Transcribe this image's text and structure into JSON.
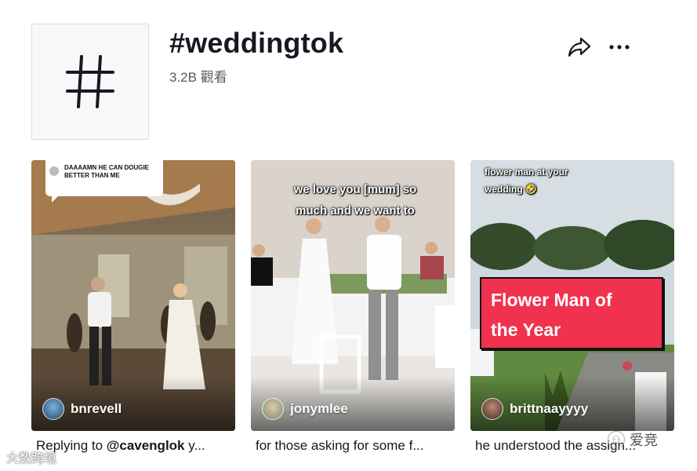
{
  "header": {
    "title": "#weddingtok",
    "views": "3.2B 觀看"
  },
  "icons": {
    "hashtag": "hashtag-icon",
    "share": "share-icon",
    "more": "more-horizontal-icon"
  },
  "videos": [
    {
      "author": "bnrevell",
      "caption_mention": "Replying to ",
      "caption_strong": "@cavenglok",
      "caption_rest": " y...",
      "reply_text": "DAAAAMN HE CAN DOUGIE BETTER THAN ME"
    },
    {
      "author": "jonymlee",
      "caption": "for those asking for some f...",
      "overlay": "we love you [mum] so much and we want to"
    },
    {
      "author": "brittnaayyyy",
      "caption": "he understood the assign...",
      "overlay": "flower man at your wedding 🤣",
      "badge_line1": "Flower Man of",
      "badge_line2": "the Year"
    }
  ],
  "watermarks": {
    "left": "大数跨境",
    "right": "爱竞"
  }
}
